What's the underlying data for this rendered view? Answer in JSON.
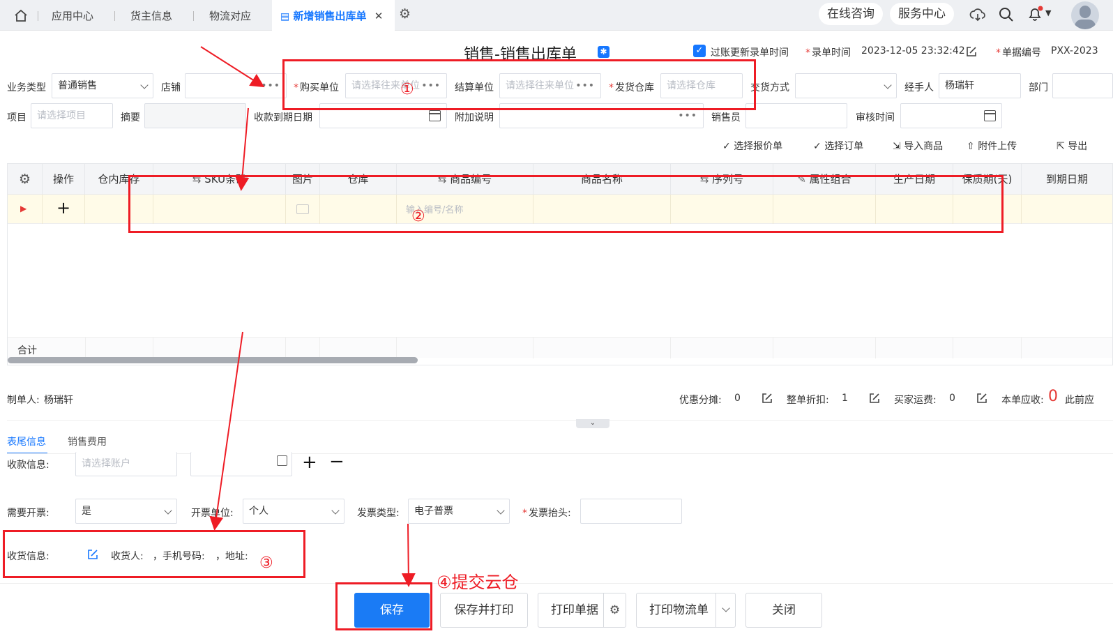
{
  "tabs": {
    "app_center": "应用中心",
    "owner_info": "货主信息",
    "logistics": "物流对应",
    "active": "新增销售出库单"
  },
  "top_actions": {
    "consult": "在线咨询",
    "service": "服务中心"
  },
  "page_title": "销售-销售出库单",
  "header_meta": {
    "posting_update_label": "过账更新录单时间",
    "entry_time_label": "录单时间",
    "entry_time_value": "2023-12-05 23:32:42",
    "doc_no_label": "单据编号",
    "doc_no_value": "PXX-2023"
  },
  "form": {
    "biz_type_label": "业务类型",
    "biz_type_value": "普通销售",
    "store_label": "店铺",
    "buyer_label": "购买单位",
    "buyer_placeholder": "请选择往来单位",
    "settle_label": "结算单位",
    "settle_placeholder": "请选择往来单位",
    "warehouse_label": "发货仓库",
    "warehouse_placeholder": "请选择仓库",
    "delivery_label": "交货方式",
    "handler_label": "经手人",
    "handler_value": "杨瑞轩",
    "dept_label": "部门",
    "project_label": "项目",
    "project_placeholder": "请选择项目",
    "summary_label": "摘要",
    "due_label": "收款到期日期",
    "remark_label": "附加说明",
    "seller_label": "销售员",
    "audit_label": "审核时间"
  },
  "toolbar": {
    "select_quote": "选择报价单",
    "select_order": "选择订单",
    "import_goods": "导入商品",
    "attach_upload": "附件上传",
    "export": "导出"
  },
  "table": {
    "columns": [
      "操作",
      "仓内库存",
      "SKU条码",
      "图片",
      "仓库",
      "商品编号",
      "商品名称",
      "序列号",
      "属性组合",
      "生产日期",
      "保质期(天)",
      "到期日期"
    ],
    "row_placeholder": "输入编号/名称",
    "total_label": "合计"
  },
  "summary": {
    "maker_label": "制单人:",
    "maker_value": "杨瑞轩",
    "discount_share_label": "优惠分摊:",
    "discount_share_value": "0",
    "whole_discount_label": "整单折扣:",
    "whole_discount_value": "1",
    "freight_label": "买家运费:",
    "freight_value": "0",
    "receivable_label": "本单应收:",
    "receivable_value": "0",
    "prev_label": "此前应"
  },
  "bottom_tabs": {
    "tail": "表尾信息",
    "fees": "销售费用"
  },
  "tail": {
    "payment_label": "收款信息:",
    "payment_placeholder": "请选择账户",
    "need_invoice_label": "需要开票:",
    "need_invoice_value": "是",
    "invoice_unit_label": "开票单位:",
    "invoice_unit_value": "个人",
    "invoice_type_label": "发票类型:",
    "invoice_type_value": "电子普票",
    "invoice_title_label": "发票抬头:",
    "receive_label": "收货信息:",
    "receiver_label": "收货人:",
    "phone_label": "，手机号码:",
    "address_label": "，地址:"
  },
  "annotations": {
    "c1": "①",
    "c2": "②",
    "c3": "③",
    "c4": "④提交云仓"
  },
  "buttons": {
    "save": "保存",
    "save_print": "保存并打印",
    "print_doc": "打印单据",
    "print_logistics": "打印物流单",
    "close": "关闭"
  },
  "colors": {
    "accent": "#1677ff",
    "annotation": "#ee1c25",
    "primary_button": "#1a7bf5"
  }
}
